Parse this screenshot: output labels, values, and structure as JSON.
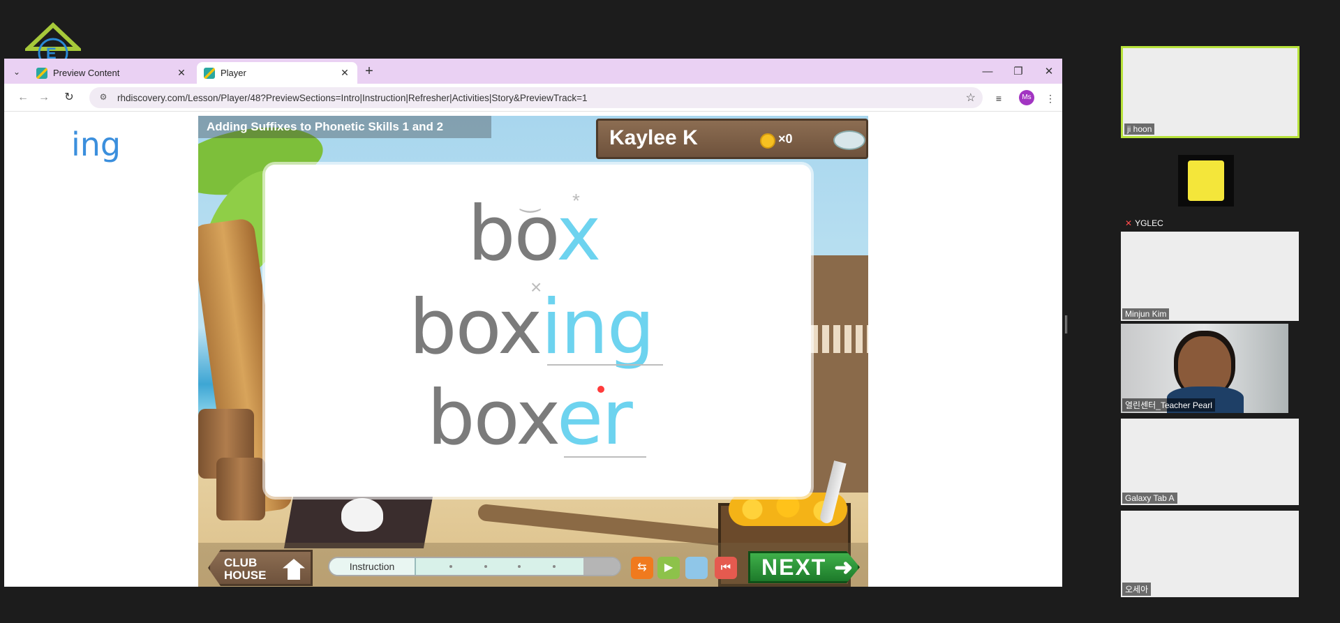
{
  "browser": {
    "tabs": [
      {
        "title": "Preview Content",
        "active": false
      },
      {
        "title": "Player",
        "active": true
      }
    ],
    "url": "rhdiscovery.com/Lesson/Player/48?PreviewSections=Intro|Instruction|Refresher|Activities|Story&PreviewTrack=1",
    "profile_initials": "Ms"
  },
  "side_word": "ing",
  "game": {
    "lesson_title": "Adding Suffixes to Phonetic Skills 1 and 2",
    "player_name": "Kaylee K",
    "coin_count": "×0",
    "words": [
      {
        "base": "bo",
        "suffix": "x"
      },
      {
        "base": "box",
        "suffix": "ing"
      },
      {
        "base": "box",
        "suffix": "er"
      }
    ],
    "marks": {
      "breve": "‿",
      "star": "*",
      "cross": "×"
    },
    "clubhouse_label_1": "CLUB",
    "clubhouse_label_2": "HOUSE",
    "progress_label": "Instruction",
    "progress_value": 0.88,
    "next_label": "NEXT",
    "colors": {
      "suffix": "#6dd3ef",
      "base": "#7b7b7b",
      "next": "#2c9a3a"
    }
  },
  "participants": [
    {
      "name": "ji hoon",
      "active_speaker": true,
      "muted": false
    },
    {
      "name": "YGLEC",
      "active_speaker": false,
      "muted": true
    },
    {
      "name": "Minjun Kim",
      "active_speaker": false,
      "muted": false
    },
    {
      "name": "열린센터_Teacher Pearl",
      "active_speaker": false,
      "muted": false
    },
    {
      "name": "Galaxy Tab A",
      "active_speaker": false,
      "muted": false
    },
    {
      "name": "오세아",
      "active_speaker": false,
      "muted": false
    }
  ]
}
